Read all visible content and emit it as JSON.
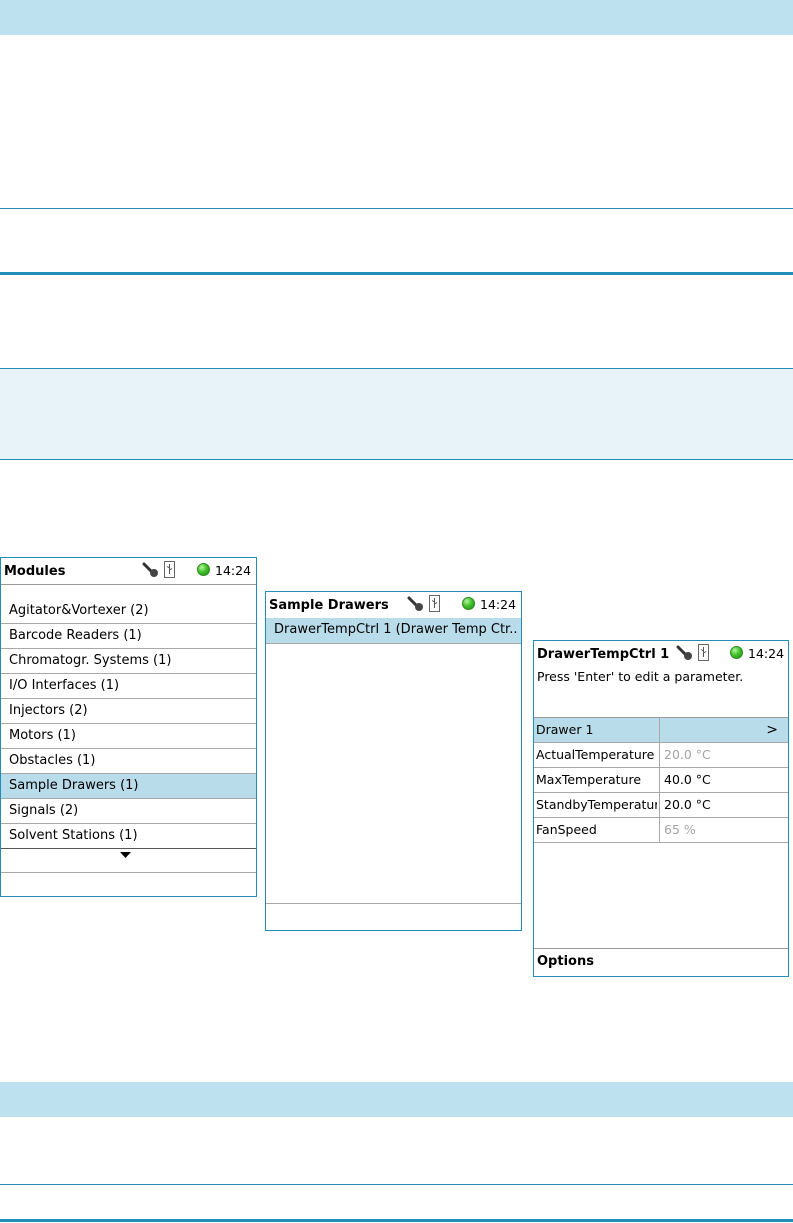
{
  "modules_screen": {
    "title": "Modules",
    "time": "14:24",
    "items": [
      {
        "label": "Agitator&Vortexer (2)"
      },
      {
        "label": "Barcode Readers (1)"
      },
      {
        "label": "Chromatogr. Systems (1)"
      },
      {
        "label": "I/O Interfaces (1)"
      },
      {
        "label": "Injectors (2)"
      },
      {
        "label": "Motors (1)"
      },
      {
        "label": "Obstacles (1)"
      },
      {
        "label": "Sample Drawers (1)",
        "selected": true
      },
      {
        "label": "Signals (2)"
      },
      {
        "label": "Solvent Stations (1)"
      }
    ],
    "more_icon": "triangle-down-icon"
  },
  "drawers_screen": {
    "title": "Sample Drawers",
    "time": "14:24",
    "items": [
      {
        "label": "DrawerTempCtrl 1 (Drawer Temp Ctr..",
        "selected": true
      }
    ]
  },
  "detail_screen": {
    "title": "DrawerTempCtrl 1",
    "time": "14:24",
    "hint": "Press 'Enter' to edit a parameter.",
    "rows": [
      {
        "name": "Drawer 1",
        "value": ">",
        "selected": true
      },
      {
        "name": "ActualTemperature",
        "value": "20.0 °C",
        "readonly": true
      },
      {
        "name": "MaxTemperature",
        "value": "40.0 °C"
      },
      {
        "name": "StandbyTemperature",
        "value": "20.0 °C"
      },
      {
        "name": "FanSpeed",
        "value": "65 %",
        "readonly": true
      }
    ],
    "options_label": "Options"
  },
  "icons": {
    "status": [
      "wrench-key-icon",
      "usb-icon",
      "status-led-icon"
    ]
  },
  "colors": {
    "band": "#bde1ee",
    "frame": "#1f8fb7",
    "selection": "#b9dceb",
    "led": "#44c22c"
  }
}
